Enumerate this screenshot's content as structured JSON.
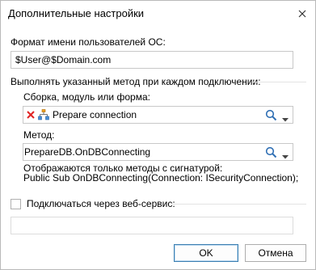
{
  "dialog": {
    "title": "Дополнительные настройки"
  },
  "os_user_format": {
    "label": "Формат имени пользователей ОС:",
    "value": "$User@$Domain.com"
  },
  "method_section": {
    "label": "Выполнять указанный метод при каждом подключении:",
    "module_label": "Сборка, модуль или форма:",
    "module_value": "Prepare connection",
    "method_label": "Метод:",
    "method_value": "PrepareDB.OnDBConnecting",
    "signature_note_line1": "Отображаются только методы с сигнатурой:",
    "signature_note_line2": "Public Sub OnDBConnecting(Connection: ISecurityConnection);"
  },
  "web_service": {
    "checkbox_label": "Подключаться через веб-сервис:",
    "checked": false,
    "value": ""
  },
  "buttons": {
    "ok_label": "OK",
    "cancel_label": "Отмена"
  },
  "icons": {
    "clear": "clear-red-x-icon",
    "module": "module-tree-icon",
    "search": "search-icon",
    "dropdown": "chevron-down-icon",
    "close": "close-icon"
  },
  "colors": {
    "ok_border": "#3c7fb1",
    "clear_icon": "#e02424",
    "search_icon": "#2f6fb4"
  }
}
